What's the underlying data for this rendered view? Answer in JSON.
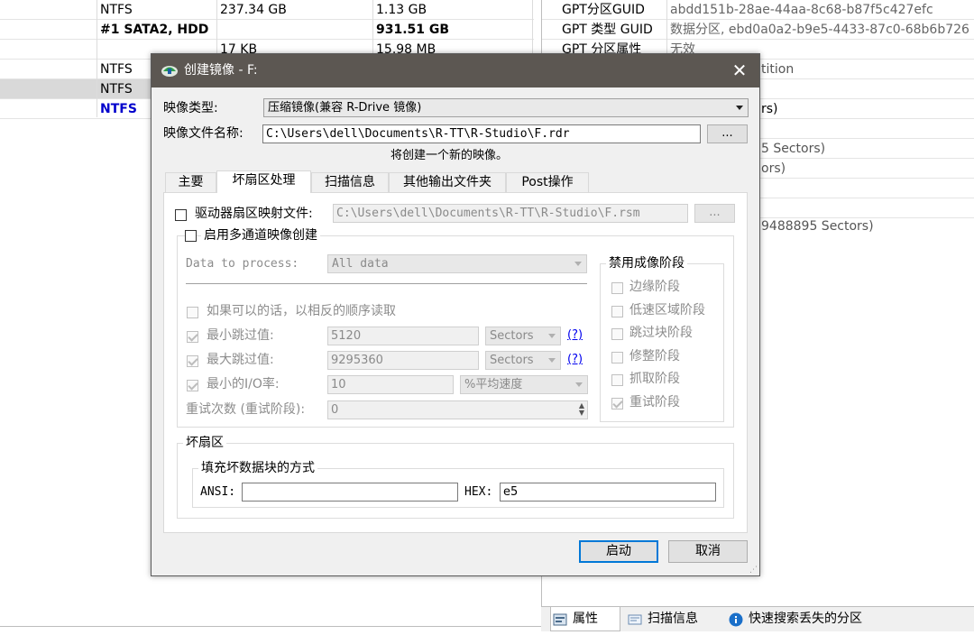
{
  "left_table": {
    "rows": [
      {
        "fs": "NTFS",
        "size": "237.34 GB",
        "free": "1.13 GB",
        "bold": false
      },
      {
        "fs": "#1 SATA2, HDD",
        "size": "",
        "free": "931.51 GB",
        "bold": true
      },
      {
        "fs": "",
        "size": "17 KB",
        "free": "15.98 MB",
        "bold": false
      },
      {
        "fs": "NTFS",
        "size": "",
        "free": "",
        "bold": false
      },
      {
        "fs": "NTFS",
        "size": "",
        "free": "",
        "bold": false
      },
      {
        "fs": "NTFS",
        "size": "",
        "free": "",
        "bold": true
      }
    ]
  },
  "right_panel": {
    "rows": [
      {
        "key": "GPT分区GUID",
        "value": "abdd151b-28ae-44aa-8c68-b87f5c427efc"
      },
      {
        "key": "GPT 类型 GUID",
        "value": "数据分区, ebd0a0a2-b9e5-4433-87c0-68b6b726"
      },
      {
        "key": "GPT 分区属性",
        "value": "无效"
      }
    ],
    "partial_texts": [
      "tition",
      "rs)",
      "5 Sectors)",
      "ors)",
      "9488895 Sectors)"
    ]
  },
  "bottom_tabs": [
    {
      "label": "属性",
      "icon": "properties-icon"
    },
    {
      "label": "扫描信息",
      "icon": "scan-info-icon"
    },
    {
      "label": "快速搜索丢失的分区",
      "icon": "info-icon"
    }
  ],
  "dialog": {
    "title": "创建镜像 - F:",
    "image_type_label": "映像类型:",
    "image_type_value": "压缩镜像(兼容 R-Drive 镜像)",
    "image_file_label": "映像文件名称:",
    "image_file_value": "C:\\Users\\dell\\Documents\\R-TT\\R-Studio\\F.rdr",
    "browse_label": "...",
    "info_text": "将创建一个新的映像。",
    "tabs": [
      "主要",
      "坏扇区处理",
      "扫描信息",
      "其他输出文件夹",
      "Post操作"
    ],
    "active_tab": 1,
    "sector_map_label": "驱动器扇区映射文件:",
    "sector_map_value": "C:\\Users\\dell\\Documents\\R-TT\\R-Studio\\F.rsm",
    "multipass_label": "启用多通道映像创建",
    "data_to_process_label": "Data to process:",
    "data_to_process_value": "All data",
    "reverse_label": "如果可以的话，以相反的顺序读取",
    "min_skip_label": "最小跳过值:",
    "min_skip_value": "5120",
    "min_skip_unit": "Sectors",
    "max_skip_label": "最大跳过值:",
    "max_skip_value": "9295360",
    "max_skip_unit": "Sectors",
    "help_link": "(?)",
    "min_io_label": "最小的I/O率:",
    "min_io_value": "10",
    "min_io_unit": "%平均速度",
    "retry_label": "重试次数 (重试阶段):",
    "retry_value": "0",
    "disable_group_title": "禁用成像阶段",
    "phases": [
      {
        "label": "边缘阶段",
        "checked": false
      },
      {
        "label": "低速区域阶段",
        "checked": false
      },
      {
        "label": "跳过块阶段",
        "checked": false
      },
      {
        "label": "修整阶段",
        "checked": false
      },
      {
        "label": "抓取阶段",
        "checked": false
      },
      {
        "label": "重试阶段",
        "checked": true
      }
    ],
    "bad_sector_group_title": "坏扇区",
    "fill_group_title": "填充坏数据块的方式",
    "ansi_label": "ANSI:",
    "ansi_value": "",
    "hex_label": "HEX:",
    "hex_value": "e5",
    "start_button": "启动",
    "cancel_button": "取消"
  },
  "colors": {
    "title_bar": "#5c5752",
    "link_blue": "#0000ee",
    "default_button_border": "#0078d7",
    "ntfs_blue": "#0000cc"
  }
}
